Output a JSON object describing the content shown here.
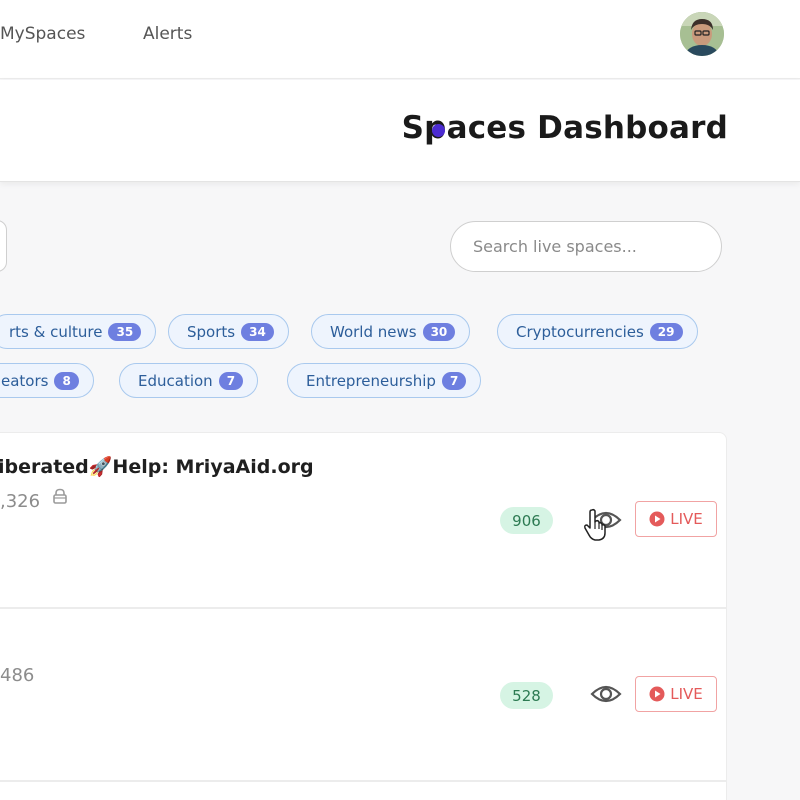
{
  "nav": {
    "myspaces": "MySpaces",
    "alerts": "Alerts",
    "avatar_icon": "user-avatar"
  },
  "header": {
    "title": "Spaces Dashboard"
  },
  "search": {
    "placeholder": "Search live spaces..."
  },
  "categories": [
    {
      "label": "rts & culture",
      "count": "35"
    },
    {
      "label": "Sports",
      "count": "34"
    },
    {
      "label": "World news",
      "count": "30"
    },
    {
      "label": "Cryptocurrencies",
      "count": "29"
    },
    {
      "label": "eators",
      "count": "8"
    },
    {
      "label": "Education",
      "count": "7"
    },
    {
      "label": "Entrepreneurship",
      "count": "7"
    }
  ],
  "spaces": [
    {
      "title": "iberated🚀Help: MriyaAid.org",
      "listeners": ",326",
      "count": "906",
      "status": "LIVE",
      "icons": [
        "lock-icon",
        "eye-icon",
        "play-icon"
      ]
    },
    {
      "title": "",
      "listeners": "486",
      "count": "528",
      "status": "LIVE",
      "icons": [
        "eye-icon",
        "play-icon"
      ]
    }
  ],
  "colors": {
    "accent_purple": "#4b2bd1",
    "chip_border": "#a9c9ee",
    "chip_bg": "#eef4fd",
    "chip_count_bg": "#6e7fe0",
    "badge_bg": "#d6f4e4",
    "badge_text": "#2c7a52",
    "live_red": "#e45a5a"
  }
}
